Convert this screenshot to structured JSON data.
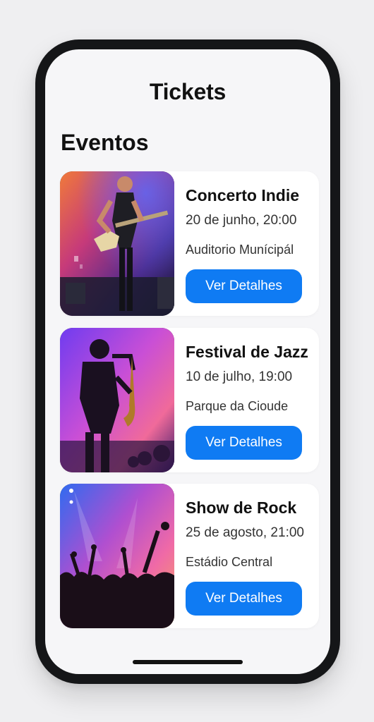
{
  "nav": {
    "title": "Tickets"
  },
  "section": {
    "title": "Eventos"
  },
  "events": [
    {
      "title": "Concerto Indie",
      "date": "20 de junho, 20:00",
      "venue": "Auditorio Munícipál",
      "button": "Ver Detalhes",
      "image": "guitarist-on-stage-photo"
    },
    {
      "title": "Festival de Jazz",
      "date": "10 de julho, 19:00",
      "venue": "Parque da Cioude",
      "button": "Ver Detalhes",
      "image": "saxophonist-silhouette-photo"
    },
    {
      "title": "Show de Rock",
      "date": "25 de agosto, 21:00",
      "venue": "Estádio Central",
      "button": "Ver Detalhes",
      "image": "concert-crowd-photo"
    }
  ],
  "colors": {
    "accent": "#0f7bf3",
    "background": "#f6f6f8",
    "card": "#ffffff",
    "phone_frame": "#151618"
  }
}
